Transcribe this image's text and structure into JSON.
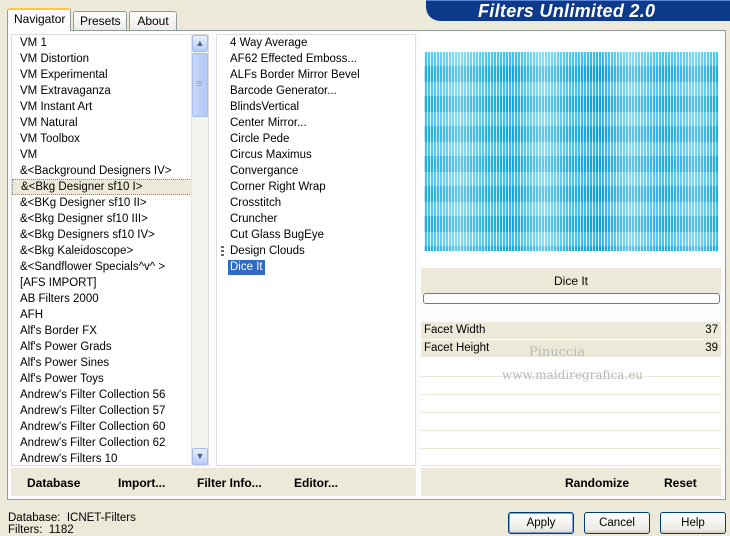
{
  "window": {
    "title": "Filters Unlimited 2.0"
  },
  "tabs": [
    {
      "label": "Navigator",
      "active": true
    },
    {
      "label": "Presets",
      "active": false
    },
    {
      "label": "About",
      "active": false
    }
  ],
  "categories": [
    "VM 1",
    "VM Distortion",
    "VM Experimental",
    "VM Extravaganza",
    "VM Instant Art",
    "VM Natural",
    "VM Toolbox",
    "VM",
    "&<Background Designers IV>",
    "&<Bkg Designer sf10 I>",
    "&<BKg Designer sf10 II>",
    "&<Bkg Designer sf10 III>",
    "&<Bkg Designers sf10 IV>",
    "&<Bkg Kaleidoscope>",
    "&<Sandflower Specials^v^ >",
    "[AFS IMPORT]",
    "AB Filters 2000",
    "AFH",
    "Alf's Border FX",
    "Alf's Power Grads",
    "Alf's Power Sines",
    "Alf's Power Toys",
    "Andrew's Filter Collection 56",
    "Andrew's Filter Collection 57",
    "Andrew's Filter Collection 60",
    "Andrew's Filter Collection 62",
    "Andrew's Filters 10"
  ],
  "selected_category": "&<Bkg Designer sf10 I>",
  "filters": [
    "4 Way Average",
    "AF62 Effected Emboss...",
    "ALFs Border Mirror Bevel",
    "Barcode Generator...",
    "BlindsVertical",
    "Center Mirror...",
    "Circle Pede",
    "Circus Maximus",
    "Convergance",
    "Corner Right Wrap",
    "Crosstitch",
    "Cruncher",
    "Cut Glass  BugEye",
    "Design Clouds",
    "Dice It"
  ],
  "selected_filter": "Dice It",
  "preview": {
    "filter_name": "Dice It",
    "accent_color": "#1ab8ea"
  },
  "params": [
    {
      "label": "Facet Width",
      "value": "37"
    },
    {
      "label": "Facet Height",
      "value": "39"
    }
  ],
  "watermark": {
    "line1": "Pinuccia",
    "line2": "www.maidiregrafica.eu"
  },
  "buttons": {
    "database": "Database",
    "import": "Import...",
    "filter_info": "Filter Info...",
    "editor": "Editor...",
    "randomize": "Randomize",
    "reset": "Reset",
    "apply": "Apply",
    "cancel": "Cancel",
    "help": "Help"
  },
  "status": {
    "database_label": "Database:",
    "database_value": "ICNET-Filters",
    "filters_label": "Filters:",
    "filters_value": "1182"
  }
}
